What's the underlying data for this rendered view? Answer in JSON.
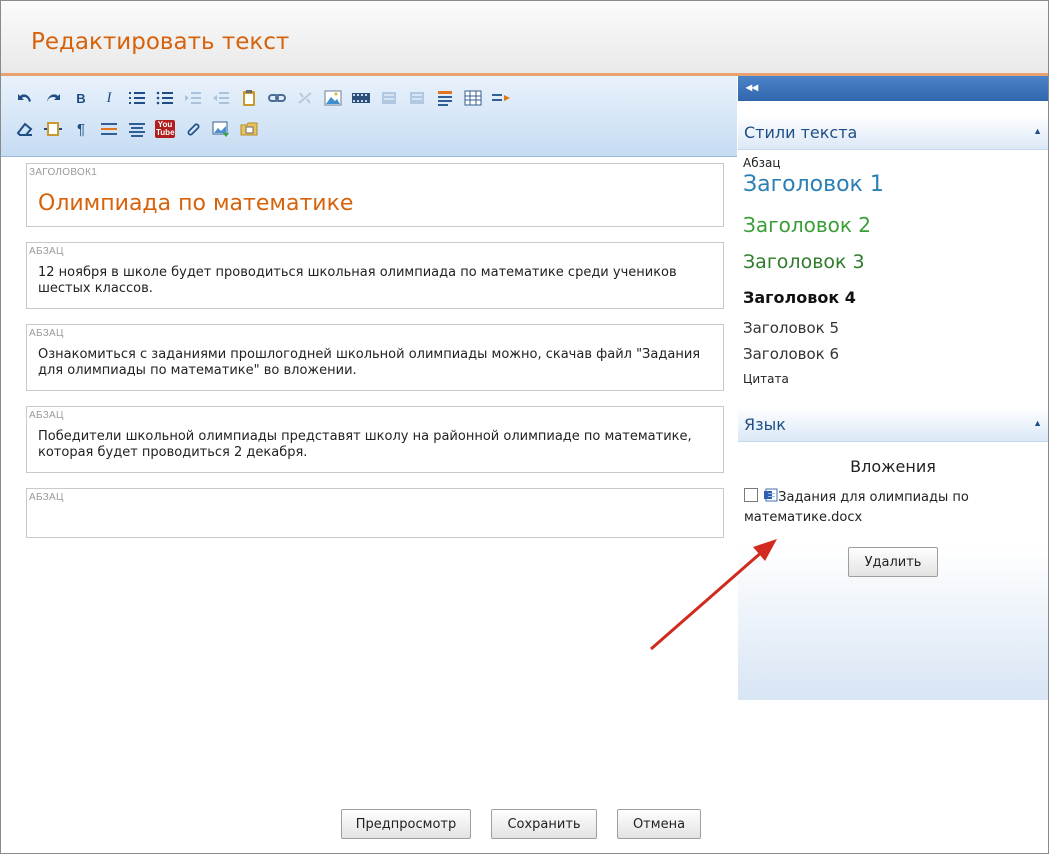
{
  "window": {
    "title": "Редактировать текст"
  },
  "toolbar": {
    "row1": [
      "undo-icon",
      "redo-icon",
      "bold-icon",
      "italic-icon",
      "numbered-list-icon",
      "bullet-list-icon",
      "indent-icon",
      "outdent-icon",
      "paste-icon",
      "link-icon",
      "unlink-icon",
      "image-icon",
      "media-icon",
      "align-left-icon",
      "align-right-icon",
      "paragraph-style-icon",
      "table-icon",
      "wrap-icon"
    ],
    "row2": [
      "eraser-icon",
      "frame-icon",
      "paragraph-mark-icon",
      "hr-icon",
      "align-center-icon",
      "youtube-icon",
      "attach-icon",
      "insert-image-icon",
      "folder-icon"
    ],
    "bold_glyph": "B",
    "italic_glyph": "I",
    "youtube_text": "You Tube"
  },
  "editor": {
    "blocks": [
      {
        "tag": "ЗАГОЛОВОК1",
        "text": "Олимпиада по математике"
      },
      {
        "tag": "АБЗАЦ",
        "text": "12 ноября в школе будет проводиться школьная олимпиада по математике среди учеников шестых классов."
      },
      {
        "tag": "АБЗАЦ",
        "text": "Ознакомиться с заданиями прошлогодней школьной олимпиады можно, скачав файл \"Задания для олимпиады по математике\" во вложении."
      },
      {
        "tag": "АБЗАЦ",
        "text": "Победители школьной олимпиады представят школу на районной олимпиаде по математике, которая будет проводиться 2 декабря."
      },
      {
        "tag": "АБЗАЦ",
        "text": ""
      }
    ]
  },
  "buttons": {
    "preview": "Предпросмотр",
    "save": "Сохранить",
    "cancel": "Отмена"
  },
  "sidebar": {
    "collapse_glyph": "◂◂",
    "styles_panel": {
      "title": "Стили текста",
      "items": [
        "Абзац",
        "Заголовок 1",
        "Заголовок 2",
        "Заголовок 3",
        "Заголовок 4",
        "Заголовок 5",
        "Заголовок 6",
        "Цитата"
      ]
    },
    "language_panel": {
      "title": "Язык"
    },
    "attachments": {
      "title": "Вложения",
      "file_name": "Задания для олимпиады по математике.docx",
      "checked": false,
      "delete_label": "Удалить"
    }
  },
  "colors": {
    "accent": "#d7620a",
    "toolbar": "#c6dcf3",
    "panel_header": "#dbe8f6",
    "arrow": "#d12a1f"
  }
}
